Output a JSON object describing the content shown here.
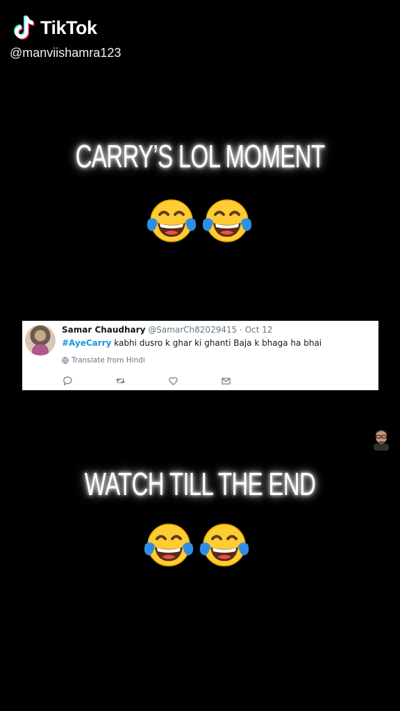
{
  "watermark": {
    "app_name": "TikTok",
    "username": "@manviishamra123"
  },
  "captions": {
    "top": "CARRY’S LOL MOMENT",
    "bottom": "WATCH TILL THE END"
  },
  "emoji": {
    "name": "face-with-tears-of-joy",
    "top_count": 2,
    "bottom_count": 2
  },
  "tweet": {
    "author_name": "Samar Chaudhary",
    "handle_date": "@SamarCh82029415 · Oct 12",
    "hashtag": "#AyeCarry",
    "text": " kabhi dusro k ghar ki ghanti Baja k bhaga ha bhai",
    "translate": "Translate from Hindi",
    "actions": [
      "reply-icon",
      "retweet-icon",
      "like-icon",
      "share-icon"
    ]
  },
  "colors": {
    "background": "#000000",
    "hashtag": "#1b95e0",
    "muted": "#657786"
  }
}
